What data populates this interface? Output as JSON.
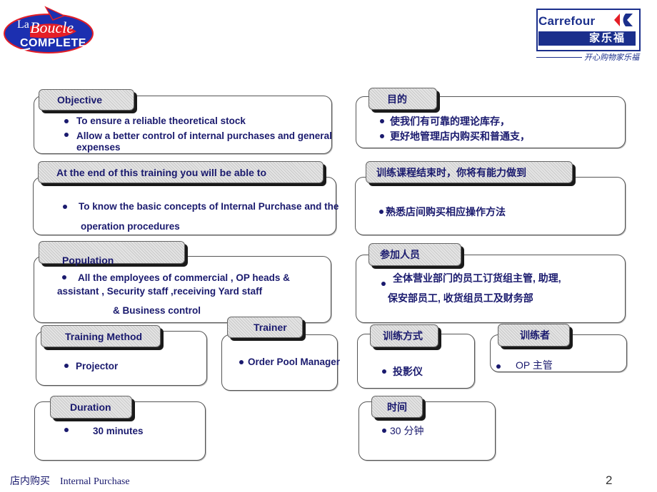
{
  "logos": {
    "left": {
      "line1": "La",
      "line2": "Boucle",
      "line3": "COMPLETE"
    },
    "right": {
      "brand": "Carrefour",
      "chinese": "家乐福",
      "slogan": "开心购物家乐福"
    }
  },
  "left_panels": {
    "objective": {
      "title": "Objective",
      "items": [
        "To ensure a reliable theoretical stock",
        "Allow a better control of internal purchases and general",
        "expenses"
      ]
    },
    "end_of_training": {
      "title": "At the end of this training you will be able to",
      "items": [
        "To know  the basic concepts of Internal Purchase and the",
        "operation procedures"
      ]
    },
    "population": {
      "title": "Population",
      "items": [
        "All the employees of commercial , OP heads &",
        "assistant , Security staff ,receiving Yard staff",
        "& Business control"
      ]
    },
    "training_method": {
      "title": "Training Method",
      "items": [
        "Projector"
      ]
    },
    "trainer": {
      "title": "Trainer",
      "items": [
        "Order Pool  Manager"
      ]
    },
    "duration": {
      "title": "Duration",
      "items": [
        "30 minutes"
      ]
    }
  },
  "right_panels": {
    "objective": {
      "title": "目的",
      "items": [
        "使我们有可靠的理论库存，",
        "更好地管理店内购买和普通支，"
      ]
    },
    "end_of_training": {
      "title": "训练课程结束时，你将有能力做到",
      "items": [
        "熟悉店间购买相应操作方法"
      ]
    },
    "population": {
      "title": "参加人员",
      "items": [
        "全体营业部门的员工订货组主管, 助理,",
        "保安部员工, 收货组员工及财务部"
      ]
    },
    "training_method": {
      "title": "训练方式",
      "items": [
        "投影仪"
      ]
    },
    "trainer": {
      "title": "训练者",
      "items": [
        "OP  主管"
      ]
    },
    "duration": {
      "title": "时间",
      "items": [
        "30  分钟"
      ]
    }
  },
  "footer": {
    "cn": "店内购买",
    "en": "Internal Purchase",
    "page": "2"
  },
  "colors": {
    "text": "#1a1a6e",
    "brand_blue": "#1b2f8c",
    "logo_red": "#e41e26"
  }
}
